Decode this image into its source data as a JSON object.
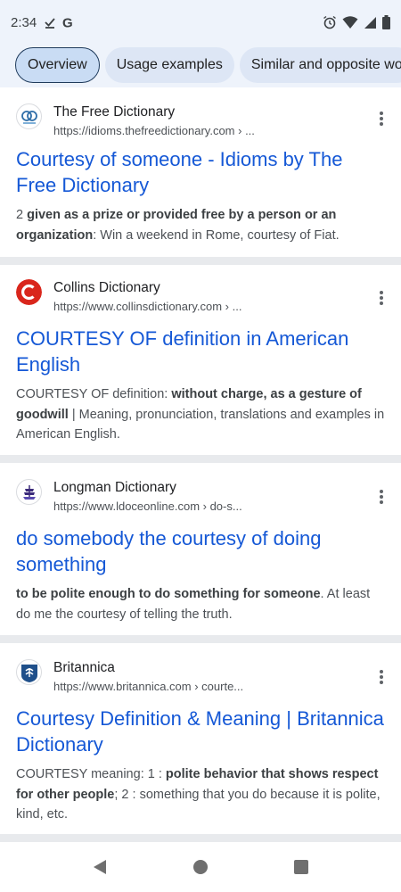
{
  "status_bar": {
    "time": "2:34",
    "left_icons": [
      "download-done-icon",
      "google-g-icon"
    ],
    "right_icons": [
      "alarm-icon",
      "wifi-icon",
      "cellular-icon",
      "battery-icon"
    ]
  },
  "chips": [
    {
      "label": "Overview",
      "active": true
    },
    {
      "label": "Usage examples",
      "active": false
    },
    {
      "label": "Similar and opposite wo",
      "active": false
    }
  ],
  "results": [
    {
      "source": "The Free Dictionary",
      "url": "https://idioms.thefreedictionary.com › ...",
      "favicon": "free-dictionary-logo",
      "title": "Courtesy of someone - Idioms by The Free Dictionary",
      "snippet_parts": [
        {
          "text": "2 ",
          "bold": false
        },
        {
          "text": "given as a prize or provided free by a person or an organization",
          "bold": true
        },
        {
          "text": ": Win a weekend in Rome, courtesy of Fiat.",
          "bold": false
        }
      ]
    },
    {
      "source": "Collins Dictionary",
      "url": "https://www.collinsdictionary.com › ...",
      "favicon": "collins-logo",
      "title": "COURTESY OF definition in American English",
      "snippet_parts": [
        {
          "text": "COURTESY OF definition: ",
          "bold": false
        },
        {
          "text": "without charge, as a gesture of goodwill",
          "bold": true
        },
        {
          "text": " | Meaning, pronunciation, translations and examples in American English.",
          "bold": false
        }
      ]
    },
    {
      "source": "Longman Dictionary",
      "url": "https://www.ldoceonline.com › do-s...",
      "favicon": "longman-logo",
      "title": "do somebody the courtesy of doing something",
      "snippet_parts": [
        {
          "text": "to be polite enough to do something for someone",
          "bold": true
        },
        {
          "text": ". At least do me the courtesy of telling the truth.",
          "bold": false
        }
      ]
    },
    {
      "source": "Britannica",
      "url": "https://www.britannica.com › courte...",
      "favicon": "britannica-logo",
      "title": "Courtesy Definition & Meaning | Britannica Dictionary",
      "snippet_parts": [
        {
          "text": "COURTESY meaning: 1 : ",
          "bold": false
        },
        {
          "text": "polite behavior that shows respect for other people",
          "bold": true
        },
        {
          "text": "; 2 : something that you do because it is polite, kind, etc.",
          "bold": false
        }
      ]
    }
  ],
  "nav_bar": {
    "buttons": [
      "back-icon",
      "home-icon",
      "recents-icon"
    ]
  },
  "colors": {
    "link": "#1558d6",
    "header_bg": "#eef3fb",
    "separator": "#e8eaed"
  }
}
